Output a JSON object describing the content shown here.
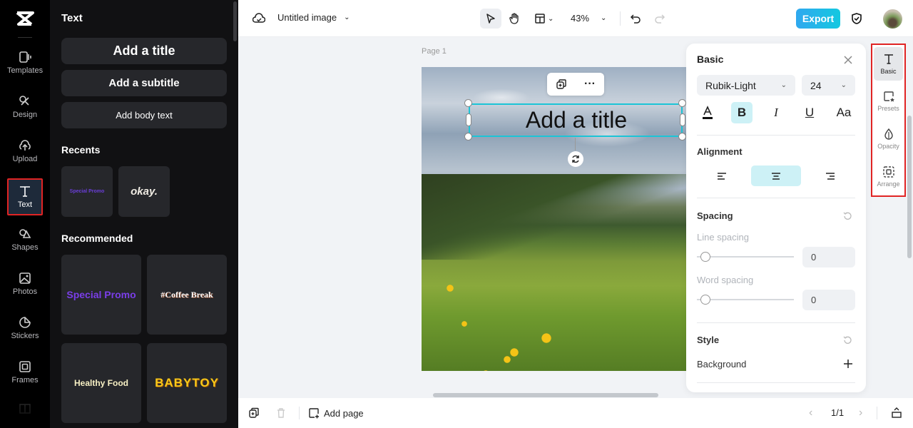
{
  "rail": {
    "items": [
      {
        "label": "Templates",
        "icon": "templates-icon"
      },
      {
        "label": "Design",
        "icon": "design-icon"
      },
      {
        "label": "Upload",
        "icon": "upload-icon"
      },
      {
        "label": "Text",
        "icon": "text-icon",
        "active": true
      },
      {
        "label": "Shapes",
        "icon": "shapes-icon"
      },
      {
        "label": "Photos",
        "icon": "photos-icon"
      },
      {
        "label": "Stickers",
        "icon": "stickers-icon"
      },
      {
        "label": "Frames",
        "icon": "frames-icon"
      }
    ]
  },
  "panel": {
    "title": "Text",
    "add_title": "Add a title",
    "add_subtitle": "Add a subtitle",
    "add_body": "Add body text",
    "recents_label": "Recents",
    "recents": [
      "Special Promo",
      "okay."
    ],
    "recommended_label": "Recommended",
    "recommended": [
      "Special Promo",
      "#Coffee Break",
      "Healthy Food",
      "BABYTOY"
    ]
  },
  "topbar": {
    "doc_title": "Untitled image",
    "zoom": "43%",
    "export_label": "Export",
    "accent": "#1cc4d6"
  },
  "canvas": {
    "page_label": "Page 1",
    "selected_text": "Add a title"
  },
  "props": {
    "title": "Basic",
    "font": "Rubik-Light",
    "size": "24",
    "format_aa": "Aa",
    "alignment_label": "Alignment",
    "spacing_label": "Spacing",
    "line_spacing_label": "Line spacing",
    "line_spacing_value": "0",
    "word_spacing_label": "Word spacing",
    "word_spacing_value": "0",
    "style_label": "Style",
    "background_label": "Background"
  },
  "right_tabs": [
    {
      "label": "Basic",
      "active": true
    },
    {
      "label": "Presets"
    },
    {
      "label": "Opacity"
    },
    {
      "label": "Arrange"
    }
  ],
  "bottombar": {
    "add_page": "Add page",
    "pager": "1/1"
  }
}
